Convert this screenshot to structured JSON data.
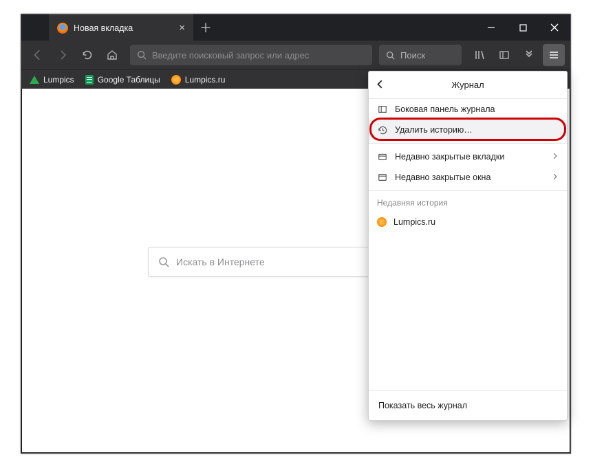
{
  "tab": {
    "title": "Новая вкладка"
  },
  "urlbar": {
    "placeholder": "Введите поисковый запрос или адрес"
  },
  "searchbar": {
    "placeholder": "Поиск"
  },
  "bookmarks": {
    "b1": "Lumpics",
    "b2": "Google Таблицы",
    "b3": "Lumpics.ru"
  },
  "content": {
    "search_placeholder": "Искать в Интернете"
  },
  "panel": {
    "title": "Журнал",
    "sidebar": "Боковая панель журнала",
    "clear": "Удалить историю…",
    "recent_tabs": "Недавно закрытые вкладки",
    "recent_windows": "Недавно закрытые окна",
    "recent_hist_title": "Недавняя история",
    "recent_item_1": "Lumpics.ru",
    "footer": "Показать весь журнал"
  }
}
